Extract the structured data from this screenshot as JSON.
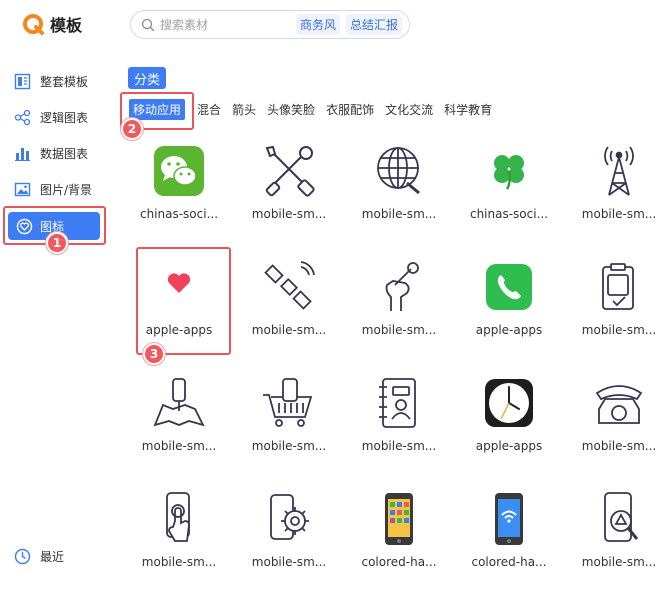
{
  "brand": {
    "title": "模板",
    "accent": "#f28a1c"
  },
  "search": {
    "placeholder": "搜索素材",
    "tags": [
      "商务风",
      "总结汇报"
    ]
  },
  "sidebar": {
    "items": [
      {
        "label": "整套模板",
        "icon": "layout-template-icon"
      },
      {
        "label": "逻辑图表",
        "icon": "flow-chart-icon"
      },
      {
        "label": "数据图表",
        "icon": "bar-chart-icon"
      },
      {
        "label": "图片/背景",
        "icon": "image-icon"
      },
      {
        "label": "图标",
        "icon": "heart-circle-icon",
        "active": true
      }
    ],
    "recent": "最近"
  },
  "category": {
    "label": "分类",
    "tabs": [
      "移动应用",
      "混合",
      "箭头",
      "头像笑脸",
      "衣服配饰",
      "文化交流",
      "科学教育"
    ],
    "active_tab": 0
  },
  "annotations": [
    "1",
    "2",
    "3"
  ],
  "grid": [
    [
      "chinas-soci...",
      "mobile-sm...",
      "mobile-sm...",
      "chinas-soci...",
      "mobile-sm..."
    ],
    [
      "apple-apps",
      "mobile-sm...",
      "mobile-sm...",
      "apple-apps",
      "mobile-sm..."
    ],
    [
      "mobile-sm...",
      "mobile-sm...",
      "mobile-sm...",
      "apple-apps",
      "mobile-sm..."
    ],
    [
      "mobile-sm...",
      "mobile-sm...",
      "colored-ha...",
      "colored-ha...",
      "mobile-sm..."
    ]
  ],
  "grid_icons": [
    [
      "wechat-icon",
      "tools-icon",
      "globe-icon",
      "clover-icon",
      "signal-tower-icon"
    ],
    [
      "heart-icon",
      "satellite-icon",
      "hand-wrench-icon",
      "phone-app-icon",
      "clipboard-phone-icon"
    ],
    [
      "map-pin-phone-icon",
      "shopping-cart-phone-icon",
      "contacts-book-icon",
      "clock-app-icon",
      "retro-telephone-icon"
    ],
    [
      "touch-phone-icon",
      "phone-gear-icon",
      "colorful-phone-icon",
      "wifi-phone-icon",
      "phone-warning-icon"
    ]
  ],
  "colors": {
    "primary": "#3d7cf2",
    "highlight": "#e8555b",
    "wechat": "#5cb531",
    "phone": "#2fbd4f"
  }
}
